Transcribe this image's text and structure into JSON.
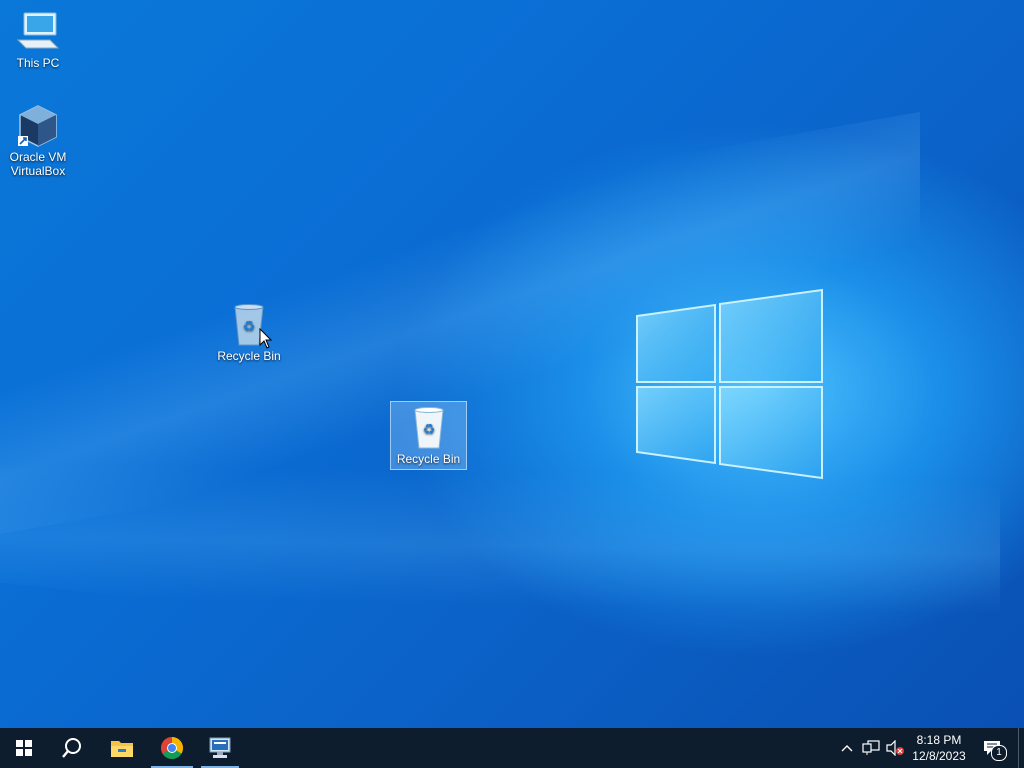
{
  "desktop": {
    "icons": [
      {
        "label": "This PC",
        "icon": "this-pc-icon"
      },
      {
        "label": "Oracle VM\nVirtualBox",
        "line1": "Oracle VM",
        "line2": "VirtualBox",
        "icon": "virtualbox-icon"
      },
      {
        "label": "Recycle Bin",
        "icon": "recycle-bin-icon"
      },
      {
        "label": "Recycle Bin",
        "icon": "recycle-bin-icon",
        "selected": true
      }
    ]
  },
  "taskbar": {
    "buttons": [
      "start-icon",
      "search-icon",
      "file-explorer-icon",
      "chrome-icon",
      "remote-desktop-icon"
    ],
    "clock": {
      "time": "8:18 PM",
      "date": "12/8/2023"
    },
    "notification_count": "1"
  },
  "colors": {
    "taskbar": "#0e1d2e",
    "desktop_accent": "#0a78d8"
  }
}
